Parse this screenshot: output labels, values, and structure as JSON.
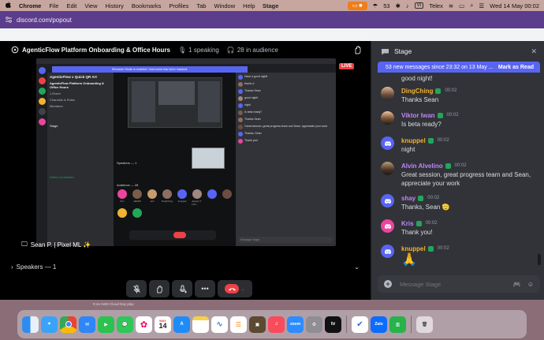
{
  "menubar": {
    "apple": "",
    "app": "Chrome",
    "items": [
      "File",
      "Edit",
      "View",
      "History",
      "Bookmarks",
      "Profiles",
      "Tab",
      "Window",
      "Help"
    ],
    "center": "Stage",
    "status_count": "53",
    "telex_box": "VI",
    "telex": "Telex",
    "datetime": "Wed 14 May  00:02"
  },
  "browser": {
    "url": "discord.com/popout"
  },
  "stage": {
    "title": "AgenticFlow Platform Onboarding & Office Hours",
    "speaking": "1 speaking",
    "audience": "28 in audience",
    "live": "LIVE",
    "sharer": "Sean P. | Pixel ML ✨",
    "speakers": "Speakers — 1",
    "mini": {
      "server_name": "AgenticFlow x Quick QR Art",
      "event_title": "AgenticFlow Platform Onboarding & Office Hours",
      "banner": "Streamer Mode is enabled. Username has been masked.",
      "channels": [
        "1 Event",
        "Channels & Roles",
        "Members"
      ],
      "stage_label": "Stage",
      "voice_connected": "Video Connected",
      "speakers_label": "Speakers — 1",
      "audience_label": "Audience — 28",
      "audience_names": [
        "Kris",
        "HENRI",
        "ash",
        "DingChing",
        "knuppel",
        "Joseph T. | Pix..."
      ],
      "chat_lines": [
        "Have a good night!",
        "thank u!",
        "Thanks Sean",
        "good night!",
        "night",
        "Is beta ready?",
        "Thanks Sean",
        "Great session, great progress team and Sean, appreciate your work",
        "Thanks, Sean",
        "Thank you!"
      ],
      "composer": "Message Stage"
    }
  },
  "chat": {
    "header": "Stage",
    "new_messages": "53 new messages since 23:32 on 13 May ...",
    "mark_read": "Mark as Read",
    "messages": [
      {
        "user": "",
        "time": "",
        "text": "good night!",
        "avatar": "photo1",
        "color": "#dbdee1"
      },
      {
        "user": "DingChing",
        "time": "00:02",
        "text": "Thanks Sean",
        "avatar": "photo1",
        "color": "#f0b232"
      },
      {
        "user": "Viktor Iwan",
        "time": "00:02",
        "text": "Is beta ready?",
        "avatar": "photo2",
        "color": "#c084fc"
      },
      {
        "user": "knuppel",
        "time": "00:02",
        "text": "night",
        "avatar": "discord",
        "color": "#f0b232"
      },
      {
        "user": "Alvin Alvelino",
        "time": "00:02",
        "text": "Great session, great progress team and Sean, appreciate your work",
        "avatar": "photo3",
        "color": "#c084fc"
      },
      {
        "user": "shay",
        "time": "00:02",
        "text": "Thanks, Sean 🫡",
        "avatar": "discord",
        "color": "#c084fc"
      },
      {
        "user": "Kris",
        "time": "00:02",
        "text": "Thank you!",
        "avatar": "pink",
        "color": "#c084fc"
      },
      {
        "user": "knuppel",
        "time": "00:02",
        "text": "🙏",
        "avatar": "discord",
        "color": "#f0b232"
      }
    ],
    "composer_placeholder": "Message Stage"
  },
  "background": {
    "below_text": "9:16 AWS Cloud Day play"
  },
  "dock": {
    "calendar_month": "MAY",
    "calendar_day": "14",
    "zoom_label": "zoom",
    "tv_label": "tv",
    "zalo_label": "Zalo",
    "apps": [
      "finder-icon",
      "safari-icon",
      "chrome-icon",
      "mail-icon",
      "facetime-icon",
      "messages-icon",
      "photos-icon",
      "calendar-icon",
      "appstore-icon",
      "notes-icon",
      "freeform-icon",
      "reminders-icon",
      "terminal-icon",
      "music-icon",
      "zoom-icon",
      "settings-icon",
      "appletv-icon",
      "cliq-icon",
      "zalo-icon",
      "numbers-icon",
      "trash-icon"
    ]
  }
}
